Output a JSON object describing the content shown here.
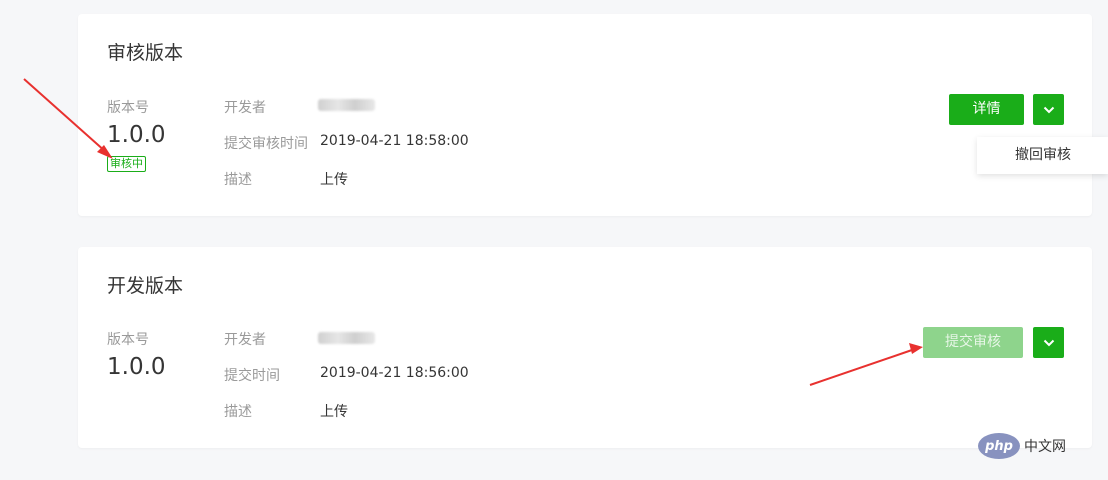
{
  "review_version": {
    "title": "审核版本",
    "version_label": "版本号",
    "version": "1.0.0",
    "status_badge": "审核中",
    "developer_label": "开发者",
    "submit_time_label": "提交审核时间",
    "submit_time": "2019-04-21 18:58:00",
    "description_label": "描述",
    "description": "上传",
    "details_button": "详情",
    "dropdown_item": "撤回审核"
  },
  "dev_version": {
    "title": "开发版本",
    "version_label": "版本号",
    "version": "1.0.0",
    "developer_label": "开发者",
    "submit_time_label": "提交时间",
    "submit_time": "2019-04-21 18:56:00",
    "description_label": "描述",
    "description": "上传",
    "submit_review_button": "提交审核"
  },
  "watermark": {
    "logo_text": "php",
    "site_text": "中文网"
  },
  "icons": {
    "more": "chevron-down-icon"
  },
  "colors": {
    "primary_green": "#1aad19",
    "disabled_green": "#8ed48c",
    "annotation_red": "#e8312f"
  }
}
